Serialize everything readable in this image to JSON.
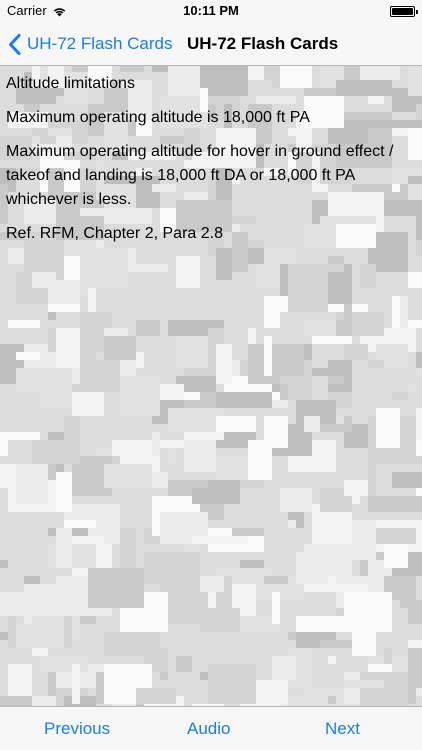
{
  "status_bar": {
    "carrier": "Carrier",
    "time": "10:11 PM"
  },
  "nav": {
    "back_label": "UH-72 Flash Cards",
    "title": "UH-72 Flash Cards"
  },
  "card": {
    "heading": "Altitude limitations",
    "line1": "Maximum operating altitude is 18,000 ft PA",
    "line2": "Maximum operating altitude for hover in ground effect / takeof and landing is 18,000 ft DA or 18,000 ft PA whichever is less.",
    "reference": "Ref. RFM, Chapter 2, Para 2.8"
  },
  "toolbar": {
    "previous_label": "Previous",
    "audio_label": "Audio",
    "next_label": "Next"
  },
  "colors": {
    "accent": "#1a7cf5",
    "bar_background": "#f7f7f7"
  },
  "icons": {
    "back": "chevron-left-icon",
    "wifi": "wifi-icon",
    "battery": "battery-icon"
  }
}
